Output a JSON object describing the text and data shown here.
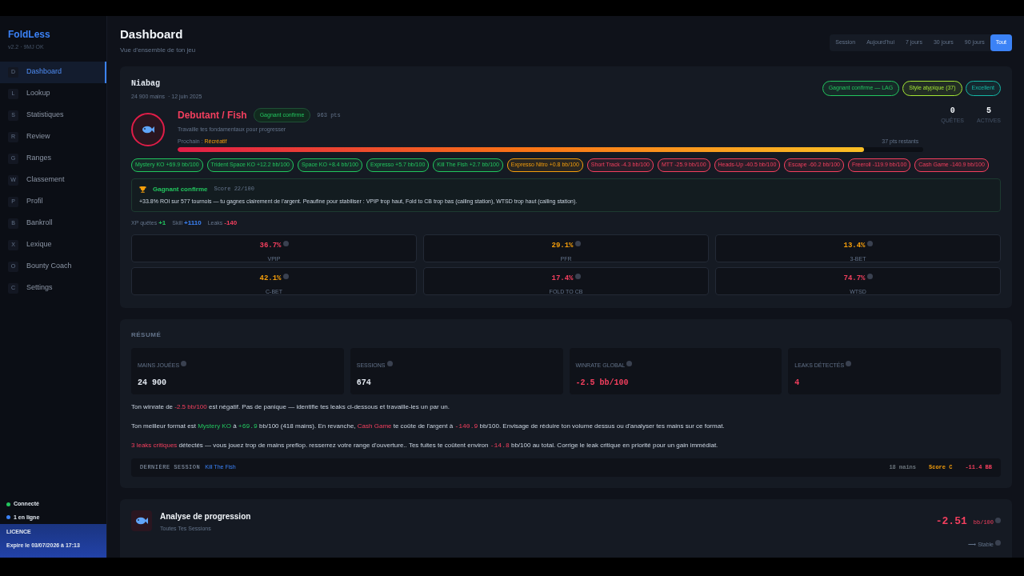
{
  "sidebar": {
    "brand": "FoldLess",
    "version": "v2.2 · 9MJ OK",
    "items": [
      {
        "key": "D",
        "label": "Dashboard",
        "selected": true
      },
      {
        "key": "L",
        "label": "Lookup",
        "selected": false
      },
      {
        "key": "S",
        "label": "Statistiques",
        "selected": false
      },
      {
        "key": "R",
        "label": "Review",
        "selected": false
      },
      {
        "key": "G",
        "label": "Ranges",
        "selected": false
      },
      {
        "key": "W",
        "label": "Classement",
        "selected": false
      },
      {
        "key": "P",
        "label": "Profil",
        "selected": false
      },
      {
        "key": "B",
        "label": "Bankroll",
        "selected": false
      },
      {
        "key": "X",
        "label": "Lexique",
        "selected": false
      },
      {
        "key": "O",
        "label": "Bounty Coach",
        "selected": false
      },
      {
        "key": "C",
        "label": "Settings",
        "selected": false
      }
    ],
    "status": [
      {
        "label": "Connecté",
        "color": "#22c55e"
      },
      {
        "label": "1 en ligne",
        "color": "#3b82f6"
      }
    ],
    "license": {
      "title": "LICENCE",
      "text": "Expire le 03/07/2026 à 17:13"
    }
  },
  "header": {
    "title": "Dashboard",
    "subtitle": "Vue d'ensemble de ton jeu",
    "periods": [
      {
        "label": "Session",
        "selected": false
      },
      {
        "label": "Aujourd'hui",
        "selected": false
      },
      {
        "label": "7 jours",
        "selected": false
      },
      {
        "label": "30 jours",
        "selected": false
      },
      {
        "label": "90 jours",
        "selected": false
      },
      {
        "label": "Tout",
        "selected": true
      }
    ]
  },
  "profile": {
    "name": "Niabag",
    "hands": "24 900 mains",
    "date": "· 12 juin 2025",
    "badges": [
      {
        "label": "Gagnant confirme — LAG",
        "color": "#22c55e"
      },
      {
        "label": "Style atypique (37)",
        "color": "#a3e635"
      },
      {
        "label": "Excellent",
        "color": "#14b8a6"
      }
    ],
    "rank": {
      "title": "Debutant / Fish",
      "badge": "Gagnant confirme",
      "points": "963 pts",
      "advice": "Travaille tes fondamentaux pour progresser",
      "next_label": "Prochain :",
      "next_value": "Récréatif",
      "level": 0.92,
      "remaining": "37 pts restants"
    },
    "counters": [
      {
        "value": "0",
        "label": "QUÊTES"
      },
      {
        "value": "5",
        "label": "ACTIVES"
      }
    ],
    "formats": [
      {
        "label": "Mystery KO +69.9 bb/100",
        "color": "#22c55e"
      },
      {
        "label": "Trident Space KO +12.2 bb/100",
        "color": "#22c55e"
      },
      {
        "label": "Space KO +8.4 bb/100",
        "color": "#22c55e"
      },
      {
        "label": "Expresso +5.7 bb/100",
        "color": "#22c55e"
      },
      {
        "label": "Kill The Fish +2.7 bb/100",
        "color": "#22c55e"
      },
      {
        "label": "Expresso Nitro +0.8 bb/100",
        "color": "#f59e0b"
      },
      {
        "label": "Short Track -4.3 bb/100",
        "color": "#f43f5e"
      },
      {
        "label": "MTT -25.9 bb/100",
        "color": "#f43f5e"
      },
      {
        "label": "Heads-Up -40.5 bb/100",
        "color": "#f43f5e"
      },
      {
        "label": "Escape -60.2 bb/100",
        "color": "#f43f5e"
      },
      {
        "label": "Freeroll -119.9 bb/100",
        "color": "#f43f5e"
      },
      {
        "label": "Cash Game -140.9 bb/100",
        "color": "#f43f5e"
      }
    ],
    "verdict": {
      "title": "Gagnant confirme",
      "score": "Score 22/100",
      "text": "+33.8% ROI sur 577 tournois — tu gagnes clairement de l'argent. Peaufine pour stabiliser : VPIP trop haut, Fold to CB trop bas (calling station), WTSD trop haut (calling station)."
    },
    "rewards": [
      {
        "label": "XP quêtes",
        "value": "+1",
        "color": "#22c55e"
      },
      {
        "label": "Skill",
        "value": "+1110",
        "color": "#3b82f6"
      },
      {
        "label": "Leaks",
        "value": "-140",
        "color": "#f43f5e"
      }
    ],
    "stats": [
      {
        "value": "36.7%",
        "label": "VPIP",
        "color": "#f43f5e"
      },
      {
        "value": "29.1%",
        "label": "PFR",
        "color": "#f59e0b"
      },
      {
        "value": "13.4%",
        "label": "3-BET",
        "color": "#f59e0b"
      },
      {
        "value": "42.1%",
        "label": "C-BET",
        "color": "#f59e0b"
      },
      {
        "value": "17.4%",
        "label": "FOLD TO CB",
        "color": "#f43f5e"
      },
      {
        "value": "74.7%",
        "label": "WTSD",
        "color": "#f43f5e"
      }
    ]
  },
  "summary": {
    "title": "RÉSUMÉ",
    "tiles": [
      {
        "label": "MAINS JOUÉES",
        "value": "24 900",
        "color": "#e2e8f0"
      },
      {
        "label": "SESSIONS",
        "value": "674",
        "color": "#e2e8f0"
      },
      {
        "label": "WINRATE GLOBAL",
        "value": "-2.5 bb/100",
        "color": "#f43f5e"
      },
      {
        "label": "LEAKS DÉTECTÉS",
        "value": "4",
        "color": "#f43f5e"
      }
    ],
    "paragraphs": [
      [
        {
          "text": "Ton winrate de ",
          "kind": "plain"
        },
        {
          "text": "-2.5 bb/100",
          "kind": "bad"
        },
        {
          "text": " est négatif. Pas de panique — identifie tes leaks ci-dessous et travaille-les un par un.",
          "kind": "plain"
        }
      ],
      [
        {
          "text": "Ton meilleur format est ",
          "kind": "plain"
        },
        {
          "text": "Mystery KO",
          "kind": "good"
        },
        {
          "text": " à ",
          "kind": "plain"
        },
        {
          "text": "+69.9",
          "kind": "good-num"
        },
        {
          "text": " bb/100 (418 mains). En revanche, ",
          "kind": "plain"
        },
        {
          "text": "Cash Game",
          "kind": "bad"
        },
        {
          "text": " te coûte de l'argent à ",
          "kind": "plain"
        },
        {
          "text": "-140.9",
          "kind": "bad-num"
        },
        {
          "text": " bb/100. Envisage de réduire ton volume dessus ou d'analyser tes mains sur ce format.",
          "kind": "plain"
        }
      ],
      [
        {
          "text": "3 leaks critiques",
          "kind": "bad"
        },
        {
          "text": " détectés — vous jouez trop de mains preflop. resserrez votre range d'ouverture.. Tes fuites te coûtent environ ",
          "kind": "plain"
        },
        {
          "text": "-14.8",
          "kind": "bad-num"
        },
        {
          "text": " bb/100 au total. Corrige le leak critique en priorité pour un gain immédiat.",
          "kind": "plain"
        }
      ]
    ],
    "last_session": {
      "label": "DERNIÈRE SESSION",
      "name": "Kill The Fish",
      "hands": "18 mains",
      "score": "Score C",
      "result": "-11.4 BB"
    }
  },
  "progression": {
    "title": "Analyse de progression",
    "subtitle": "Toutes Tes Sessions",
    "value": "-2.51",
    "unit": "bb/100",
    "trend": "⟶ Stable"
  }
}
